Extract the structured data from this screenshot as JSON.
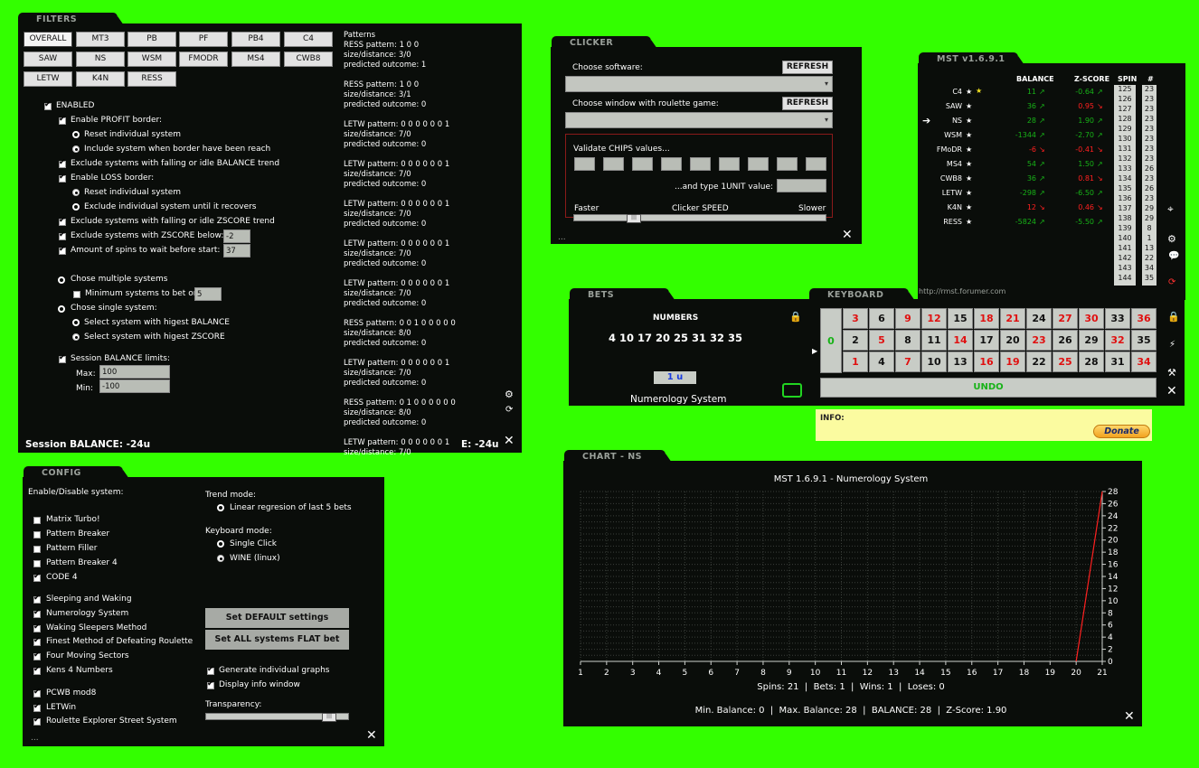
{
  "filters": {
    "tab": "FILTERS",
    "buttons": [
      "OVERALL",
      "MT3",
      "PB",
      "PF",
      "PB4",
      "C4",
      "SAW",
      "NS",
      "WSM",
      "FMODR",
      "MS4",
      "CWB8",
      "LETW",
      "K4N",
      "RESS"
    ],
    "enabled": "ENABLED",
    "enable_profit": "Enable PROFIT border:",
    "reset_individual": "Reset individual system",
    "include_system": "Include system when border have been reach",
    "exclude_balance": "Exclude systems with falling or idle BALANCE trend",
    "enable_loss": "Enable LOSS border:",
    "reset_individual2": "Reset individual system",
    "exclude_individual": "Exclude individual system until it recovers",
    "exclude_zscore_trend": "Exclude systems with falling or idle ZSCORE trend",
    "exclude_zscore_below": "Exclude systems with ZSCORE below:",
    "zscore_below_value": "-2",
    "amount_spins": "Amount of spins to wait before start:",
    "amount_spins_value": "37",
    "chose_multiple": "Chose multiple systems",
    "min_systems": "Minimum systems to bet on:",
    "min_systems_value": "5",
    "chose_single": "Chose single system:",
    "select_balance": "Select system with higest BALANCE",
    "select_zscore": "Select system with higest ZSCORE",
    "session_limits": "Session BALANCE limits:",
    "max_label": "Max:",
    "max_value": "100",
    "min_label": "Min:",
    "min_value": "-100",
    "session_balance": "Session BALANCE: -24u",
    "e_value": "E: -24u",
    "patterns_title": "Patterns",
    "patterns": [
      [
        "RESS pattern: 1 0 0",
        "size/distance: 3/0",
        "predicted outcome: 1"
      ],
      [
        "RESS pattern: 1 0 0",
        "size/distance: 3/1",
        "predicted outcome: 0"
      ],
      [
        "LETW pattern: 0 0 0 0 0 0 1",
        "size/distance: 7/0",
        "predicted outcome: 0"
      ],
      [
        "LETW pattern: 0 0 0 0 0 0 1",
        "size/distance: 7/0",
        "predicted outcome: 0"
      ],
      [
        "LETW pattern: 0 0 0 0 0 0 1",
        "size/distance: 7/0",
        "predicted outcome: 0"
      ],
      [
        "LETW pattern: 0 0 0 0 0 0 1",
        "size/distance: 7/0",
        "predicted outcome: 0"
      ],
      [
        "LETW pattern: 0 0 0 0 0 0 1",
        "size/distance: 7/0",
        "predicted outcome: 0"
      ],
      [
        "RESS pattern: 0 0 1 0 0 0 0 0",
        "size/distance: 8/0",
        "predicted outcome: 0"
      ],
      [
        "LETW pattern: 0 0 0 0 0 0 1",
        "size/distance: 7/0",
        "predicted outcome: 0"
      ],
      [
        "RESS pattern: 0 1 0 0 0 0 0 0",
        "size/distance: 8/0",
        "predicted outcome: 0"
      ],
      [
        "LETW pattern: 0 0 0 0 0 0 1",
        "size/distance: 7/0",
        ""
      ]
    ]
  },
  "clicker": {
    "tab": "CLICKER",
    "choose_software": "Choose software:",
    "refresh": "REFRESH",
    "choose_window": "Choose window with roulette game:",
    "refresh2": "REFRESH",
    "validate": "Validate CHIPS values...",
    "type_unit": "...and type 1UNIT value:",
    "faster": "Faster",
    "speed": "Clicker SPEED",
    "slower": "Slower",
    "dots": "..."
  },
  "mst": {
    "tab": "MST v1.6.9.1",
    "col_balance": "BALANCE",
    "col_zscore": "Z-SCORE",
    "col_spin": "SPIN",
    "col_hash": "#",
    "rows": [
      {
        "name": "C4",
        "balance": "11",
        "zscore": "-0.64",
        "bcolor": "#17b217",
        "zcolor": "#17b217"
      },
      {
        "name": "SAW",
        "balance": "36",
        "zscore": "0.95",
        "bcolor": "#17b217",
        "zcolor": "#ff2020"
      },
      {
        "name": "NS",
        "balance": "28",
        "zscore": "1.90",
        "bcolor": "#17b217",
        "zcolor": "#17b217"
      },
      {
        "name": "WSM",
        "balance": "-1344",
        "zscore": "-2.70",
        "bcolor": "#17b217",
        "zcolor": "#17b217"
      },
      {
        "name": "FMoDR",
        "balance": "-6",
        "zscore": "-0.41",
        "bcolor": "#ff2020",
        "zcolor": "#ff2020"
      },
      {
        "name": "MS4",
        "balance": "54",
        "zscore": "1.50",
        "bcolor": "#17b217",
        "zcolor": "#17b217"
      },
      {
        "name": "CWB8",
        "balance": "36",
        "zscore": "0.81",
        "bcolor": "#17b217",
        "zcolor": "#ff2020"
      },
      {
        "name": "LETW",
        "balance": "-298",
        "zscore": "-6.50",
        "bcolor": "#17b217",
        "zcolor": "#17b217"
      },
      {
        "name": "K4N",
        "balance": "12",
        "zscore": "0.46",
        "bcolor": "#ff2020",
        "zcolor": "#ff2020"
      },
      {
        "name": "RESS",
        "balance": "-5824",
        "zscore": "-5.50",
        "bcolor": "#17b217",
        "zcolor": "#17b217"
      }
    ],
    "spins": [
      "125",
      "126",
      "127",
      "128",
      "129",
      "130",
      "131",
      "132",
      "133",
      "134",
      "135",
      "136",
      "137",
      "138",
      "139",
      "140",
      "141",
      "142",
      "143",
      "144"
    ],
    "hashes": [
      "23",
      "23",
      "23",
      "23",
      "23",
      "23",
      "23",
      "23",
      "26",
      "23",
      "26",
      "23",
      "29",
      "29",
      "8",
      "1",
      "13",
      "22",
      "34",
      "35"
    ],
    "url": "http://rmst.forumer.com"
  },
  "bets": {
    "tab": "BETS",
    "numbers_label": "NUMBERS",
    "numbers": "4 10 17 20 25 31 32 35",
    "unit": "1 u",
    "system": "Numerology System"
  },
  "keyboard": {
    "tab": "KEYBOARD",
    "zero": "0",
    "rows": [
      [
        [
          "3",
          "r"
        ],
        [
          "6",
          ""
        ],
        [
          "9",
          "r"
        ],
        [
          "12",
          "r"
        ],
        [
          "15",
          ""
        ],
        [
          "18",
          "r"
        ],
        [
          "21",
          "r"
        ],
        [
          "24",
          ""
        ],
        [
          "27",
          "r"
        ],
        [
          "30",
          "r"
        ],
        [
          "33",
          ""
        ],
        [
          "36",
          "r"
        ]
      ],
      [
        [
          "2",
          ""
        ],
        [
          "5",
          "r"
        ],
        [
          "8",
          ""
        ],
        [
          "11",
          ""
        ],
        [
          "14",
          "r"
        ],
        [
          "17",
          ""
        ],
        [
          "20",
          ""
        ],
        [
          "23",
          "r"
        ],
        [
          "26",
          ""
        ],
        [
          "29",
          ""
        ],
        [
          "32",
          "r"
        ],
        [
          "35",
          ""
        ]
      ],
      [
        [
          "1",
          "r"
        ],
        [
          "4",
          ""
        ],
        [
          "7",
          "r"
        ],
        [
          "10",
          ""
        ],
        [
          "13",
          ""
        ],
        [
          "16",
          "r"
        ],
        [
          "19",
          "r"
        ],
        [
          "22",
          ""
        ],
        [
          "25",
          "r"
        ],
        [
          "28",
          ""
        ],
        [
          "31",
          ""
        ],
        [
          "34",
          "r"
        ]
      ]
    ],
    "undo": "UNDO"
  },
  "info": {
    "label": "INFO:",
    "donate": "Donate"
  },
  "config": {
    "tab": "CONFIG",
    "enable_disable": "Enable/Disable system:",
    "systems": [
      {
        "label": "Matrix Turbo!",
        "on": false
      },
      {
        "label": "Pattern Breaker",
        "on": false
      },
      {
        "label": "Pattern Filler",
        "on": false
      },
      {
        "label": "Pattern Breaker 4",
        "on": false
      },
      {
        "label": "CODE 4",
        "on": true
      },
      {
        "label": "Sleeping and Waking",
        "on": true
      },
      {
        "label": "Numerology System",
        "on": true
      },
      {
        "label": "Waking Sleepers Method",
        "on": true
      },
      {
        "label": "Finest Method of Defeating Roulette",
        "on": true
      },
      {
        "label": "Four Moving Sectors",
        "on": true
      },
      {
        "label": "Kens 4 Numbers",
        "on": true
      },
      {
        "label": "PCWB mod8",
        "on": true
      },
      {
        "label": "LETWin",
        "on": true
      },
      {
        "label": "Roulette Explorer Street System",
        "on": true
      }
    ],
    "trend_mode": "Trend mode:",
    "linear": "Linear regresion of last 5 bets",
    "keyboard_mode": "Keyboard mode:",
    "single_click": "Single Click",
    "wine": "WINE (linux)",
    "set_default": "Set DEFAULT settings",
    "set_flat": "Set ALL systems FLAT bet",
    "gen_graphs": "Generate individual graphs",
    "display_info": "Display info window",
    "transparency": "Transparency:",
    "dots": "..."
  },
  "chart": {
    "tab": "CHART - NS",
    "stats1": "Spins: 21  |  Bets: 1  |  Wins: 1  |  Loses: 0",
    "stats2": "Min. Balance: 0  |  Max. Balance: 28  |  BALANCE: 28  |  Z-Score: 1.90"
  },
  "chart_data": {
    "type": "line",
    "title": "MST 1.6.9.1  -  Numerology System",
    "x": [
      1,
      2,
      3,
      4,
      5,
      6,
      7,
      8,
      9,
      10,
      11,
      12,
      13,
      14,
      15,
      16,
      17,
      18,
      19,
      20,
      21
    ],
    "series": [
      {
        "values": [
          0,
          0,
          0,
          0,
          0,
          0,
          0,
          0,
          0,
          0,
          0,
          0,
          0,
          0,
          0,
          0,
          0,
          0,
          0,
          0,
          28
        ]
      }
    ],
    "xticks": [
      "1",
      "2",
      "3",
      "4",
      "5",
      "6",
      "7",
      "8",
      "9",
      "10",
      "11",
      "12",
      "13",
      "14",
      "15",
      "16",
      "17",
      "18",
      "19",
      "20",
      "21"
    ],
    "yticks": [
      "0",
      "2",
      "4",
      "6",
      "8",
      "10",
      "12",
      "14",
      "16",
      "18",
      "20",
      "22",
      "24",
      "26",
      "28"
    ],
    "ylim": [
      0,
      28
    ],
    "grid": true,
    "line_color": "#ff2020"
  }
}
